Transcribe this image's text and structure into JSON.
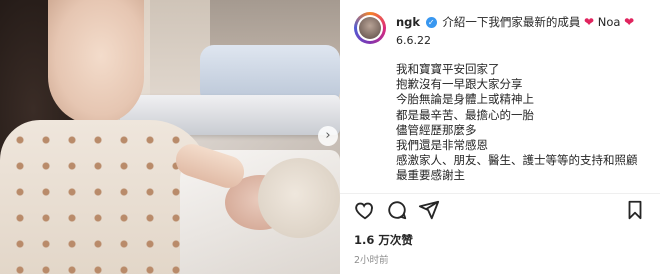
{
  "post": {
    "username": "ngk",
    "title": "介紹一下我們家最新的成員",
    "name_tag": "Noa",
    "date": "6.6.22",
    "lines": [
      "我和寶寶平安回家了",
      "抱歉沒有一早跟大家分享",
      "今胎無論是身體上或精神上",
      "都是最辛苦、最擔心的一胎",
      "儘管經歷那麼多",
      "我們還是非常感恩",
      "感激家人、朋友、醫生、護士等等的支持和照顧",
      "最重要感謝主"
    ],
    "likes": "1.6 万次赞",
    "time": "2小时前"
  },
  "icons": {
    "verified": "verified-badge-icon",
    "heart": "heart-icon",
    "like": "like-heart-icon",
    "comment": "comment-icon",
    "share": "share-icon",
    "save": "bookmark-icon",
    "next": "chevron-right-icon"
  },
  "colors": {
    "heart": "#e0245e",
    "verified": "#3897f0"
  }
}
